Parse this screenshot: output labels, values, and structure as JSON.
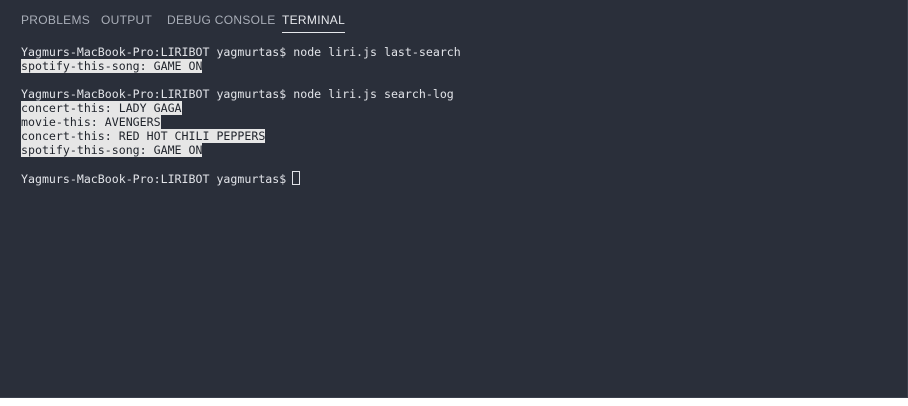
{
  "tabs": [
    {
      "label": "PROBLEMS",
      "active": false
    },
    {
      "label": "OUTPUT",
      "active": false
    },
    {
      "label": "DEBUG CONSOLE",
      "active": false
    },
    {
      "label": "TERMINAL",
      "active": true
    }
  ],
  "terminal": {
    "block1": {
      "prompt": "Yagmurs-MacBook-Pro:LIRIBOT yagmurtas$",
      "command": "node liri.js last-search",
      "output": [
        "spotify-this-song: GAME ON"
      ]
    },
    "block2": {
      "prompt": "Yagmurs-MacBook-Pro:LIRIBOT yagmurtas$",
      "command": "node liri.js search-log",
      "output": [
        "concert-this: LADY GAGA",
        "movie-this: AVENGERS",
        "concert-this: RED HOT CHILI PEPPERS",
        "spotify-this-song: GAME ON"
      ]
    },
    "current_prompt": "Yagmurs-MacBook-Pro:LIRIBOT yagmurtas$"
  },
  "colors": {
    "panel_background": "#2a2f3a",
    "text": "#e1e3e8",
    "tab_inactive": "#a9aeb8",
    "selection_background": "#e6e6e6"
  }
}
